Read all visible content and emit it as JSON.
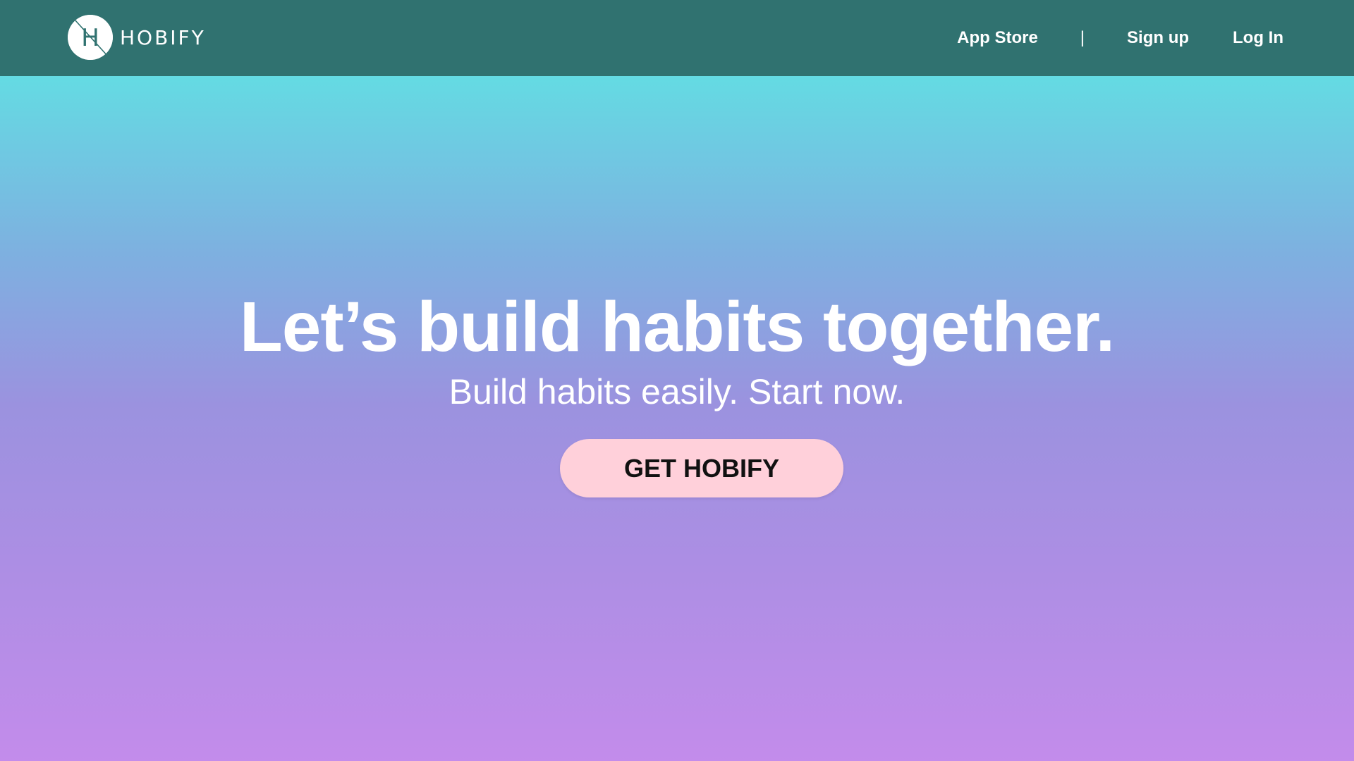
{
  "brand": {
    "name": "HOBIFY",
    "logo_letter": "H"
  },
  "nav": {
    "app_store": "App Store",
    "separator": "|",
    "sign_up": "Sign up",
    "log_in": "Log In"
  },
  "hero": {
    "headline": "Let’s build habits together.",
    "subheadline": "Build habits easily. Start now.",
    "cta_label": "GET HOBIFY"
  },
  "colors": {
    "topbar": "#307270",
    "gradient_top": "#64dbe3",
    "gradient_bottom": "#c38ceb",
    "cta_background": "#ffd0da",
    "text": "#ffffff"
  }
}
